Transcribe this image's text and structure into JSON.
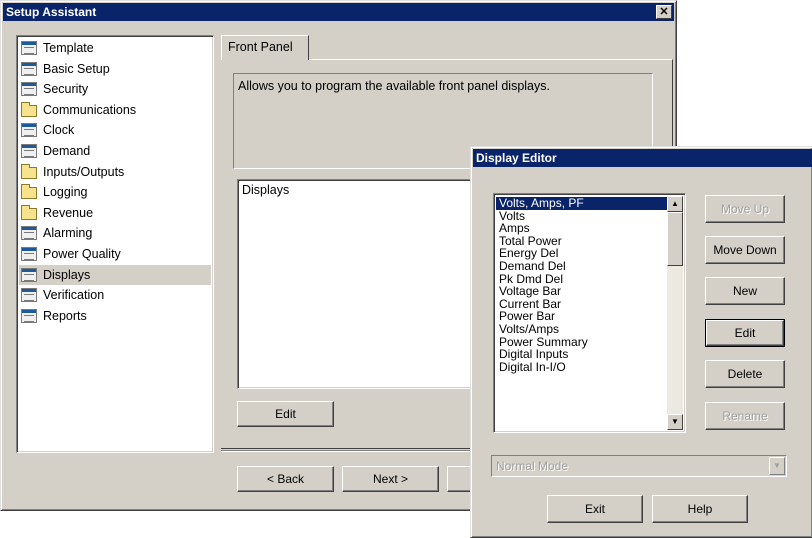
{
  "setup": {
    "title": "Setup Assistant",
    "close_glyph": "✕",
    "nav": [
      {
        "label": "Template",
        "icon": "page"
      },
      {
        "label": "Basic Setup",
        "icon": "page"
      },
      {
        "label": "Security",
        "icon": "page"
      },
      {
        "label": "Communications",
        "icon": "folder"
      },
      {
        "label": "Clock",
        "icon": "page"
      },
      {
        "label": "Demand",
        "icon": "page"
      },
      {
        "label": "Inputs/Outputs",
        "icon": "folder"
      },
      {
        "label": "Logging",
        "icon": "folder"
      },
      {
        "label": "Revenue",
        "icon": "folder"
      },
      {
        "label": "Alarming",
        "icon": "page"
      },
      {
        "label": "Power Quality",
        "icon": "page"
      },
      {
        "label": "Displays",
        "icon": "page"
      },
      {
        "label": "Verification",
        "icon": "page"
      },
      {
        "label": "Reports",
        "icon": "page"
      }
    ],
    "selected_nav": "Displays",
    "tab_label": "Front Panel",
    "description": "Allows you to program the available front panel displays.",
    "list_header": "Displays",
    "edit_label": "Edit",
    "back_label": "< Back",
    "next_label": "Next >"
  },
  "editor": {
    "title": "Display Editor",
    "items": [
      "Volts, Amps, PF",
      "Volts",
      "Amps",
      "Total Power",
      "Energy Del",
      "Demand Del",
      "Pk Dmd Del",
      "Voltage Bar",
      "Current Bar",
      "Power Bar",
      "Volts/Amps",
      "Power Summary",
      "Digital Inputs",
      "Digital In-I/O"
    ],
    "selected_item": "Volts, Amps, PF",
    "move_up_label": "Move Up",
    "move_down_label": "Move Down",
    "new_label": "New",
    "edit_label": "Edit",
    "delete_label": "Delete",
    "rename_label": "Rename",
    "mode_value": "Normal Mode",
    "exit_label": "Exit",
    "help_label": "Help",
    "scroll_up_glyph": "▲",
    "scroll_down_glyph": "▼"
  }
}
